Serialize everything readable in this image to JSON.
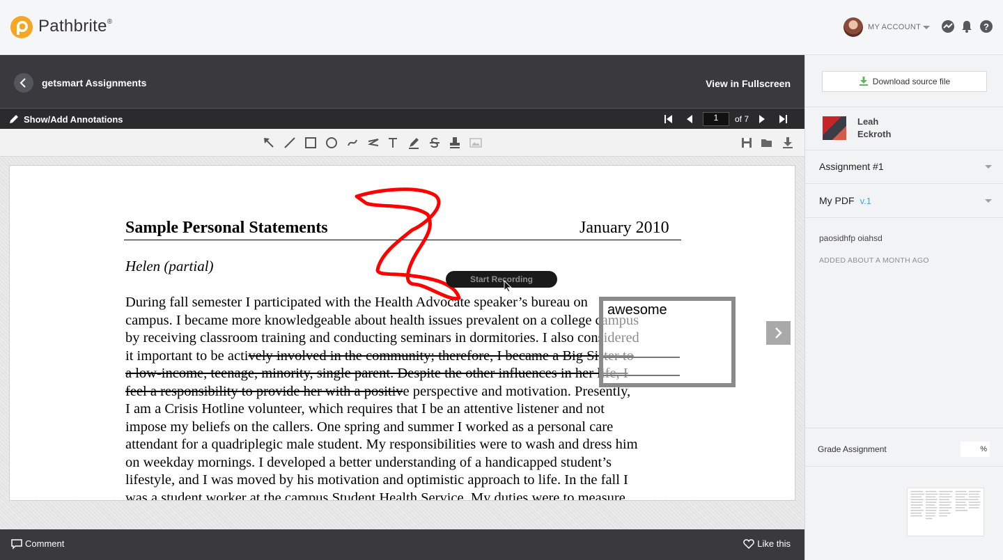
{
  "brand": {
    "name": "Pathbrite",
    "registered": "®",
    "accent": "#f5a623"
  },
  "header": {
    "account_label": "MY ACCOUNT"
  },
  "viewer": {
    "title": "getsmart Assignments",
    "fullscreen_label": "View in Fullscreen",
    "annotations_label": "Show/Add Annotations",
    "page_current": "1",
    "page_total_label": "of 7",
    "comment_label": "Comment",
    "like_label": "Like this"
  },
  "toolbar": {
    "tools": [
      "arrow-tool-icon",
      "line-tool-icon",
      "rectangle-tool-icon",
      "ellipse-tool-icon",
      "freehand-tool-icon",
      "polyline-tool-icon",
      "text-tool-icon",
      "highlight-tool-icon",
      "strikeout-tool-icon",
      "stamp-tool-icon",
      "image-tool-icon"
    ],
    "file_actions": [
      "save-icon",
      "open-folder-icon",
      "download-icon"
    ]
  },
  "document": {
    "title": "Sample Personal Statements",
    "date": "January 2010",
    "author": "Helen (partial)",
    "lines": [
      [
        {
          "t": "During fall semester I participated with the Health Advocate speaker’s bureau on"
        }
      ],
      [
        {
          "t": "campus. I became more knowledgeable about health issues prevalent on a college campus"
        }
      ],
      [
        {
          "t": "by receiving classroom training and conducting seminars in dormitories. I also considered"
        }
      ],
      [
        {
          "t": "it important to be acti"
        },
        {
          "t": "vely involved in the community; therefore, I became a Big Sister to",
          "s": true
        }
      ],
      [
        {
          "t": "a low-income, teenage, minority, single parent. Despite the other influences in her life, I",
          "s": true
        }
      ],
      [
        {
          "t": "feel a responsibility to provide her with a positiv",
          "s": true
        },
        {
          "t": "e perspective and motivation. Presently,"
        }
      ],
      [
        {
          "t": "I am a Crisis Hotline volunteer, which requires that I be an attentive listener and not"
        }
      ],
      [
        {
          "t": "impose my beliefs on the callers. One spring and summer I worked as a personal care"
        }
      ],
      [
        {
          "t": "attendant for a quadriplegic male student. My responsibilities were to wash and dress him"
        }
      ],
      [
        {
          "t": "on weekday mornings. I developed a better understanding of a handicapped student’s"
        }
      ],
      [
        {
          "t": "lifestyle, and I was moved by his motivation and optimistic approach to life. In the fall I"
        }
      ],
      [
        {
          "t": "was a student worker at the campus Student Health Service. My duties were to measure"
        }
      ]
    ],
    "recording_label": "Start Recording",
    "note_text": "awesome",
    "scribble_color": "#ff0000"
  },
  "sidebar": {
    "download_label": "Download source file",
    "user_first": "Leah",
    "user_last": "Eckroth",
    "assignment_label": "Assignment #1",
    "pdf_label": "My PDF",
    "pdf_version": "v.1",
    "description": "paosidhfp oiahsd",
    "added_label": "ADDED ABOUT A MONTH AGO",
    "grade_label": "Grade Assignment",
    "grade_suffix": "%"
  }
}
